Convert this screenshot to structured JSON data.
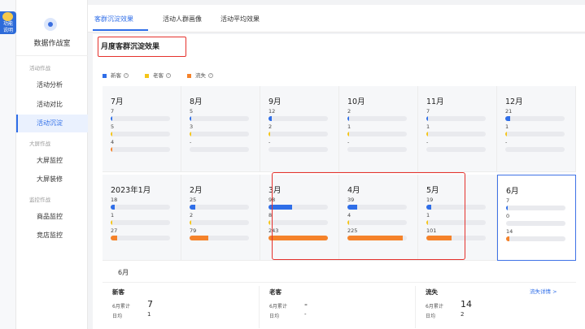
{
  "rail": {
    "label": "功能\n说明"
  },
  "app": {
    "title": "数据作战室"
  },
  "sidebar": {
    "groups": [
      {
        "label": "活动作战",
        "items": [
          "活动分析",
          "活动对比",
          "活动沉淀"
        ]
      },
      {
        "label": "大屏作战",
        "items": [
          "大屏监控",
          "大屏装修"
        ]
      },
      {
        "label": "监控作战",
        "items": [
          "商品监控",
          "竞店监控"
        ]
      }
    ],
    "active": "活动沉淀"
  },
  "tabs": [
    "客群沉淀效果",
    "活动人群画像",
    "活动平均效果"
  ],
  "section_title": "月度客群沉淀效果",
  "legend": [
    {
      "label": "新客",
      "color": "#2f6ee8"
    },
    {
      "label": "老客",
      "color": "#f5c518"
    },
    {
      "label": "流失",
      "color": "#f5822a"
    }
  ],
  "months": [
    {
      "label": "7月",
      "new": "7",
      "old": "5",
      "lost": "4",
      "new_frac": 0.03,
      "old_frac": 0.02,
      "lost_frac": 0.016
    },
    {
      "label": "8月",
      "new": "5",
      "old": "3",
      "lost": "-",
      "new_frac": 0.02,
      "old_frac": 0.012,
      "lost_frac": 0
    },
    {
      "label": "9月",
      "new": "12",
      "old": "2",
      "lost": "-",
      "new_frac": 0.05,
      "old_frac": 0.01,
      "lost_frac": 0
    },
    {
      "label": "10月",
      "new": "2",
      "old": "1",
      "lost": "-",
      "new_frac": 0.01,
      "old_frac": 0.005,
      "lost_frac": 0
    },
    {
      "label": "11月",
      "new": "7",
      "old": "1",
      "lost": "-",
      "new_frac": 0.03,
      "old_frac": 0.005,
      "lost_frac": 0
    },
    {
      "label": "12月",
      "new": "21",
      "old": "1",
      "lost": "-",
      "new_frac": 0.08,
      "old_frac": 0.005,
      "lost_frac": 0
    },
    {
      "label": "2023年1月",
      "new": "18",
      "old": "1",
      "lost": "27",
      "new_frac": 0.07,
      "old_frac": 0.005,
      "lost_frac": 0.11
    },
    {
      "label": "2月",
      "new": "25",
      "old": "2",
      "lost": "79",
      "new_frac": 0.1,
      "old_frac": 0.01,
      "lost_frac": 0.32
    },
    {
      "label": "3月",
      "new": "98",
      "old": "8",
      "lost": "243",
      "new_frac": 0.4,
      "old_frac": 0.03,
      "lost_frac": 1.0
    },
    {
      "label": "4月",
      "new": "39",
      "old": "4",
      "lost": "225",
      "new_frac": 0.16,
      "old_frac": 0.016,
      "lost_frac": 0.93
    },
    {
      "label": "5月",
      "new": "19",
      "old": "1",
      "lost": "101",
      "new_frac": 0.08,
      "old_frac": 0.005,
      "lost_frac": 0.42
    },
    {
      "label": "6月",
      "new": "7",
      "old": "0",
      "lost": "14",
      "new_frac": 0.03,
      "old_frac": 0,
      "lost_frac": 0.06
    }
  ],
  "summary": {
    "month": "6月",
    "new": {
      "title": "新客",
      "total_label": "6月累计",
      "total": "7",
      "avg_label": "日均",
      "avg": "1"
    },
    "old": {
      "title": "老客",
      "total_label": "6月累计",
      "total": "-",
      "avg_label": "日均",
      "avg": "-"
    },
    "lost": {
      "title": "流失",
      "total_label": "6月累计",
      "total": "14",
      "avg_label": "日均",
      "avg": "2"
    },
    "detail_link": "流失详情 >"
  }
}
